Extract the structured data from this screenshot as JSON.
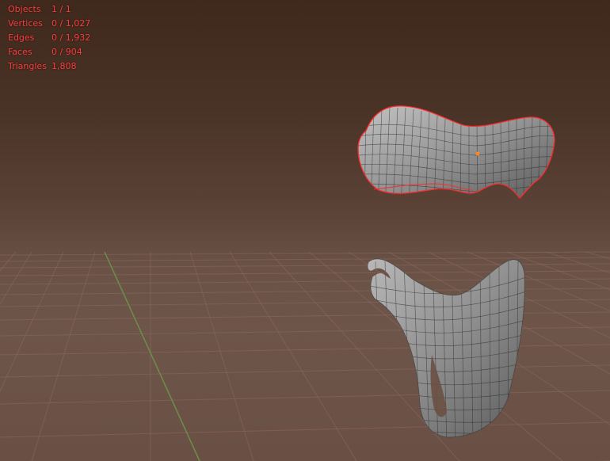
{
  "overlay": {
    "stats": [
      {
        "label": "Objects",
        "value": "1 / 1"
      },
      {
        "label": "Vertices",
        "value": "0 / 1,027"
      },
      {
        "label": "Edges",
        "value": "0 / 1,932"
      },
      {
        "label": "Faces",
        "value": "0 / 904"
      },
      {
        "label": "Triangles",
        "value": "1,808"
      }
    ]
  },
  "colors": {
    "overlay_text": "#ff3b3b",
    "grid_line": "#8a6a62",
    "y_axis": "#6b8f4a",
    "mesh_fill": "#8d8d8d",
    "mesh_wire": "#2b2b2b",
    "selection_outline": "#ff2a2a",
    "origin_point": "#ff8a1a"
  },
  "icons": {
    "object_origin": "origin-dot-icon"
  }
}
